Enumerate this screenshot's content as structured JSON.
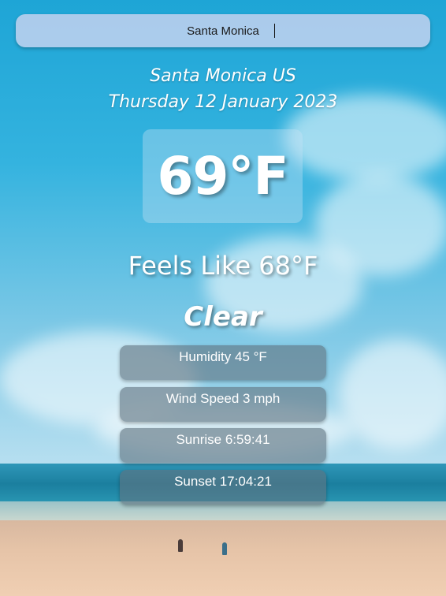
{
  "search": {
    "value": "Santa Monica",
    "placeholder": ""
  },
  "location": "Santa Monica US",
  "date": "Thursday 12 January 2023",
  "temperature": "69°F",
  "feels_like": "Feels Like 68°F",
  "condition": "Clear",
  "stats": {
    "humidity": "Humidity 45 °F",
    "wind": "Wind Speed 3 mph",
    "sunrise": "Sunrise 6:59:41",
    "sunset": "Sunset 17:04:21"
  }
}
